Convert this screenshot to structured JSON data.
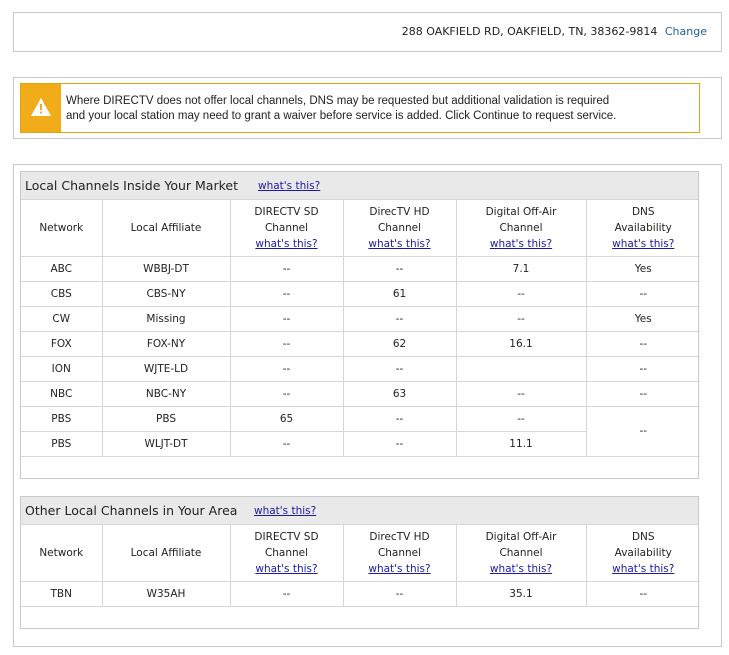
{
  "address": {
    "text": "288 OAKFIELD RD, OAKFIELD, TN, 38362-9814",
    "change_label": "Change"
  },
  "alert": {
    "icon": "warning-icon",
    "line1": "Where DIRECTV does not offer local channels, DNS may be requested but additional validation is required",
    "line2": "and your local station may need to grant a waiver before service is added. Click Continue to request service."
  },
  "columns": {
    "network": "Network",
    "affiliate": "Local Affiliate",
    "sd_1": "DIRECTV SD",
    "sd_2": "Channel",
    "hd_1": "DirecTV HD",
    "hd_2": "Channel",
    "ota_1": "Digital Off-Air",
    "ota_2": "Channel",
    "dns_1": "DNS",
    "dns_2": "Availability",
    "whats_this": "what's this?"
  },
  "inside": {
    "title": "Local Channels Inside Your Market",
    "whats_this": "what's this?",
    "rows": [
      {
        "network": "ABC",
        "affiliate": "WBBJ-DT",
        "sd": "--",
        "hd": "--",
        "ota": "7.1",
        "dns": "Yes"
      },
      {
        "network": "CBS",
        "affiliate": "CBS-NY",
        "sd": "--",
        "hd": "61",
        "ota": "--",
        "dns": "--"
      },
      {
        "network": "CW",
        "affiliate": "Missing",
        "sd": "--",
        "hd": "--",
        "ota": "--",
        "dns": "Yes"
      },
      {
        "network": "FOX",
        "affiliate": "FOX-NY",
        "sd": "--",
        "hd": "62",
        "ota": "16.1",
        "dns": "--"
      },
      {
        "network": "ION",
        "affiliate": "WJTE-LD",
        "sd": "--",
        "hd": "--",
        "ota": "",
        "dns": "--"
      },
      {
        "network": "NBC",
        "affiliate": "NBC-NY",
        "sd": "--",
        "hd": "63",
        "ota": "--",
        "dns": "--"
      },
      {
        "network": "PBS",
        "affiliate": "PBS",
        "sd": "65",
        "hd": "--",
        "ota": "--",
        "dns": "--"
      },
      {
        "network": "PBS",
        "affiliate": "WLJT-DT",
        "sd": "--",
        "hd": "--",
        "ota": "11.1",
        "dns": ""
      }
    ]
  },
  "other": {
    "title": "Other Local Channels in Your Area",
    "whats_this": "what's this?",
    "rows": [
      {
        "network": "TBN",
        "affiliate": "W35AH",
        "sd": "--",
        "hd": "--",
        "ota": "35.1",
        "dns": "--"
      }
    ]
  }
}
